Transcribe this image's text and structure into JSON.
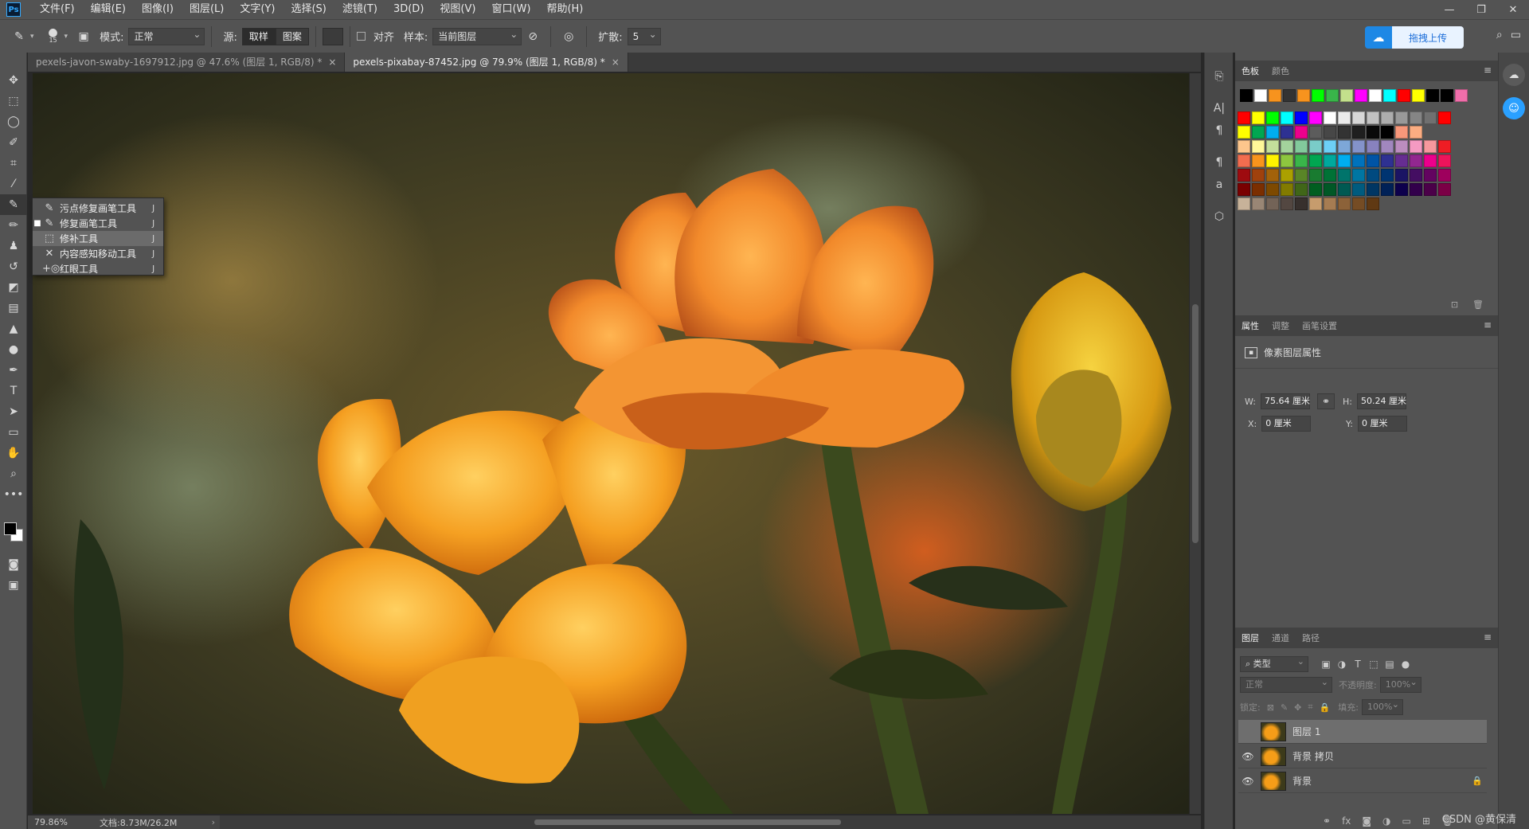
{
  "app": {
    "logo": "Ps",
    "menu": [
      "文件(F)",
      "编辑(E)",
      "图像(I)",
      "图层(L)",
      "文字(Y)",
      "选择(S)",
      "滤镜(T)",
      "3D(D)",
      "视图(V)",
      "窗口(W)",
      "帮助(H)"
    ],
    "window_controls": [
      "—",
      "❐",
      "✕"
    ]
  },
  "options": {
    "brush_size": "15",
    "mode_label": "模式:",
    "mode_value": "正常",
    "source_label": "源:",
    "source_sampled": "取样",
    "source_pattern": "图案",
    "aligned_label": "对齐",
    "sample_label": "样本:",
    "sample_value": "当前图层",
    "diffusion_label": "扩散:",
    "diffusion_value": "5",
    "upload_label": "拖拽上传"
  },
  "tabs": [
    {
      "label": "pexels-javon-swaby-1697912.jpg @ 47.6% (图层 1, RGB/8) *",
      "close": "×"
    },
    {
      "label": "pexels-pixabay-87452.jpg @ 79.9% (图层 1, RGB/8) *",
      "close": "×"
    }
  ],
  "flyout": {
    "items": [
      {
        "label": "污点修复画笔工具",
        "key": "J",
        "icon": "spot-healing-icon",
        "glyph": "✎",
        "dot": ""
      },
      {
        "label": "修复画笔工具",
        "key": "J",
        "icon": "healing-brush-icon",
        "glyph": "✎",
        "dot": "■"
      },
      {
        "label": "修补工具",
        "key": "J",
        "icon": "patch-icon",
        "glyph": "⬚",
        "dot": ""
      },
      {
        "label": "内容感知移动工具",
        "key": "J",
        "icon": "content-aware-move-icon",
        "glyph": "✕",
        "dot": ""
      },
      {
        "label": "红眼工具",
        "key": "J",
        "icon": "red-eye-icon",
        "glyph": "+◎",
        "dot": ""
      }
    ]
  },
  "status": {
    "zoom": "79.86%",
    "doc": "文档:8.73M/26.2M",
    "arrow": "›"
  },
  "swatches_panel": {
    "tabs": [
      "色板",
      "颜色"
    ],
    "row1": [
      "#000000",
      "#ffffff",
      "#f7931e",
      "#333333",
      "#f7931e",
      "#00ff00",
      "#39b54a",
      "#c3e08c",
      "#ff00ff",
      "#ffffff",
      "#00ffff",
      "#ff0000",
      "#ffff00",
      "#000000",
      "#000000",
      "#f06eaa"
    ],
    "grid": [
      [
        "#ff0000",
        "#ffff00",
        "#00ff00",
        "#00ffff",
        "#0000ff",
        "#ff00ff",
        "#ffffff",
        "#ebebeb",
        "#d7d7d7",
        "#c2c2c2",
        "#adadad",
        "#999999",
        "#858585",
        "#707070",
        "#ff0000"
      ],
      [
        "#ffff00",
        "#00a651",
        "#00aeef",
        "#2e3192",
        "#ec008c",
        "#5c5c5c",
        "#474747",
        "#333333",
        "#1f1f1f",
        "#0a0a0a",
        "#000000",
        "#f7977a",
        "#fbad82"
      ],
      [
        "#fdc68c",
        "#fff799",
        "#c4df9b",
        "#a3d39c",
        "#82ca9c",
        "#7accc8",
        "#6dcff6",
        "#7da7d8",
        "#8493ca",
        "#8882be",
        "#a187be",
        "#bc8dbf",
        "#f49ac2",
        "#f6989d",
        "#ee1d24"
      ],
      [
        "#f26c4f",
        "#f7941d",
        "#fff200",
        "#8dc63f",
        "#39b54a",
        "#00a651",
        "#00a99d",
        "#00aeef",
        "#0072bc",
        "#0054a6",
        "#2e3192",
        "#662d91",
        "#92278f",
        "#ec008c",
        "#ed145b"
      ],
      [
        "#9e0b0f",
        "#a0410d",
        "#a3620a",
        "#aba000",
        "#598527",
        "#197b30",
        "#007236",
        "#00746b",
        "#0076a3",
        "#004a80",
        "#003471",
        "#1b1464",
        "#440e62",
        "#630460",
        "#9e005d"
      ],
      [
        "#790000",
        "#7b2e00",
        "#7d4900",
        "#827b00",
        "#406618",
        "#005e20",
        "#005826",
        "#005952",
        "#005b7f",
        "#003663",
        "#002157",
        "#0d004c",
        "#32004b",
        "#4b0049",
        "#7b0046"
      ],
      [
        "#c7b299",
        "#998675",
        "#736357",
        "#534741",
        "#37302d",
        "#c69c6d",
        "#a67c52",
        "#8c6239",
        "#754c24",
        "#603913"
      ]
    ]
  },
  "properties_panel": {
    "tabs": [
      "属性",
      "调整",
      "画笔设置"
    ],
    "title": "像素图层属性",
    "w_label": "W:",
    "w_value": "75.64 厘米",
    "h_label": "H:",
    "h_value": "50.24 厘米",
    "x_label": "X:",
    "x_value": "0 厘米",
    "y_label": "Y:",
    "y_value": "0 厘米"
  },
  "layers_panel": {
    "tabs": [
      "图层",
      "通道",
      "路径"
    ],
    "filter_value": "类型",
    "blend_value": "正常",
    "opacity_label": "不透明度:",
    "opacity_value": "100%",
    "lock_label": "锁定:",
    "fill_label": "填充:",
    "fill_value": "100%",
    "layers": [
      {
        "name": "图层 1",
        "visible": false,
        "selected": true,
        "locked": false
      },
      {
        "name": "背景 拷贝",
        "visible": true,
        "selected": false,
        "locked": false
      },
      {
        "name": "背景",
        "visible": true,
        "selected": false,
        "locked": true
      }
    ]
  },
  "watermark": "CSDN @黄保清"
}
